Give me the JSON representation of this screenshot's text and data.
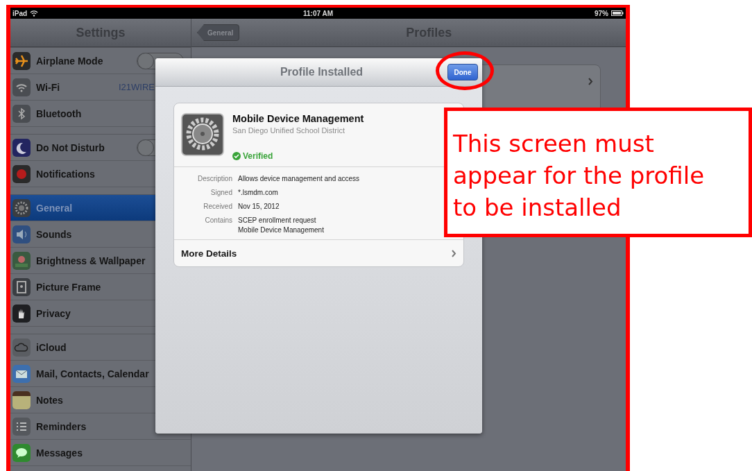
{
  "status_bar": {
    "device": "iPad",
    "time": "11:07 AM",
    "battery": "97%"
  },
  "sidebar": {
    "title": "Settings",
    "groups": [
      [
        {
          "label": "Airplane Mode",
          "kind": "toggle",
          "on": false,
          "selected": false
        },
        {
          "label": "Wi-Fi",
          "kind": "value",
          "value": "I21WIRE",
          "selected": false
        },
        {
          "label": "Bluetooth",
          "kind": "plain",
          "selected": false
        }
      ],
      [
        {
          "label": "Do Not Disturb",
          "kind": "toggle",
          "on": false,
          "selected": false
        },
        {
          "label": "Notifications",
          "kind": "plain",
          "selected": false
        }
      ],
      [
        {
          "label": "General",
          "kind": "plain",
          "selected": true
        },
        {
          "label": "Sounds",
          "kind": "plain",
          "selected": false
        },
        {
          "label": "Brightness & Wallpaper",
          "kind": "plain",
          "selected": false
        },
        {
          "label": "Picture Frame",
          "kind": "plain",
          "selected": false
        },
        {
          "label": "Privacy",
          "kind": "plain",
          "selected": false
        }
      ],
      [
        {
          "label": "iCloud",
          "kind": "plain",
          "selected": false
        },
        {
          "label": "Mail, Contacts, Calendar",
          "kind": "plain",
          "selected": false
        },
        {
          "label": "Notes",
          "kind": "plain",
          "selected": false
        },
        {
          "label": "Reminders",
          "kind": "plain",
          "selected": false
        },
        {
          "label": "Messages",
          "kind": "plain",
          "selected": false
        }
      ]
    ]
  },
  "detail": {
    "back_button": "General",
    "title": "Profiles"
  },
  "dialog": {
    "title": "Profile Installed",
    "done_button": "Done",
    "profile": {
      "name": "Mobile Device Management",
      "organization": "San Diego Unified School District",
      "status": "Verified"
    },
    "details": [
      {
        "label": "Description",
        "values": [
          "Allows device management and access"
        ]
      },
      {
        "label": "Signed",
        "values": [
          "*.lsmdm.com"
        ]
      },
      {
        "label": "Received",
        "values": [
          "Nov 15, 2012"
        ]
      },
      {
        "label": "Contains",
        "values": [
          "SCEP enrollment request",
          "Mobile Device Management"
        ]
      }
    ],
    "more_details": "More Details"
  },
  "annotation": {
    "callout": "This screen must appear for the profile to be installed"
  }
}
